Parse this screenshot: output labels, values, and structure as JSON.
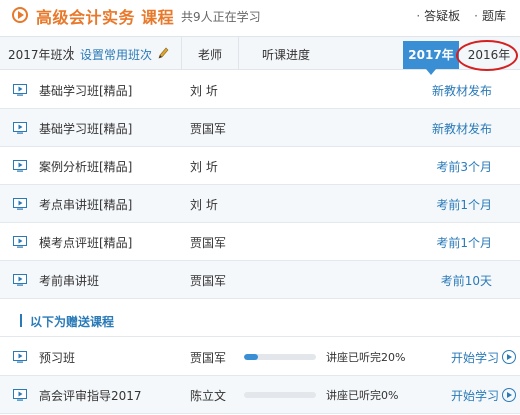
{
  "header": {
    "title": "高级会计实务 课程",
    "count": "共9人正在学习",
    "links": [
      "答疑板",
      "题库"
    ]
  },
  "tabbar": {
    "classes": "2017年班次",
    "set_link": "设置常用班次",
    "col_teacher": "老师",
    "col_progress": "听课进度",
    "year_active": "2017年",
    "year_other": "2016年"
  },
  "courses": [
    {
      "name": "基础学习班[精品]",
      "teacher": "刘  圻",
      "status": "新教材发布"
    },
    {
      "name": "基础学习班[精品]",
      "teacher": "贾国军",
      "status": "新教材发布"
    },
    {
      "name": "案例分析班[精品]",
      "teacher": "刘  圻",
      "status": "考前3个月"
    },
    {
      "name": "考点串讲班[精品]",
      "teacher": "刘  圻",
      "status": "考前1个月"
    },
    {
      "name": "模考点评班[精品]",
      "teacher": "贾国军",
      "status": "考前1个月"
    },
    {
      "name": "考前串讲班",
      "teacher": "贾国军",
      "status": "考前10天"
    }
  ],
  "gift": {
    "heading": "以下为赠送课程",
    "items": [
      {
        "name": "预习班",
        "teacher": "贾国军",
        "progress": 0.2,
        "progress_text": "讲座已听完20%",
        "action": "开始学习"
      },
      {
        "name": "高会评审指导2017",
        "teacher": "陈立文",
        "progress": 0.0,
        "progress_text": "讲座已听完0%",
        "action": "开始学习"
      }
    ]
  },
  "colors": {
    "brand_orange": "#e8782a",
    "link_blue": "#2a7ab8",
    "active_tab": "#3a8fd4",
    "highlight_red": "#d42020"
  }
}
